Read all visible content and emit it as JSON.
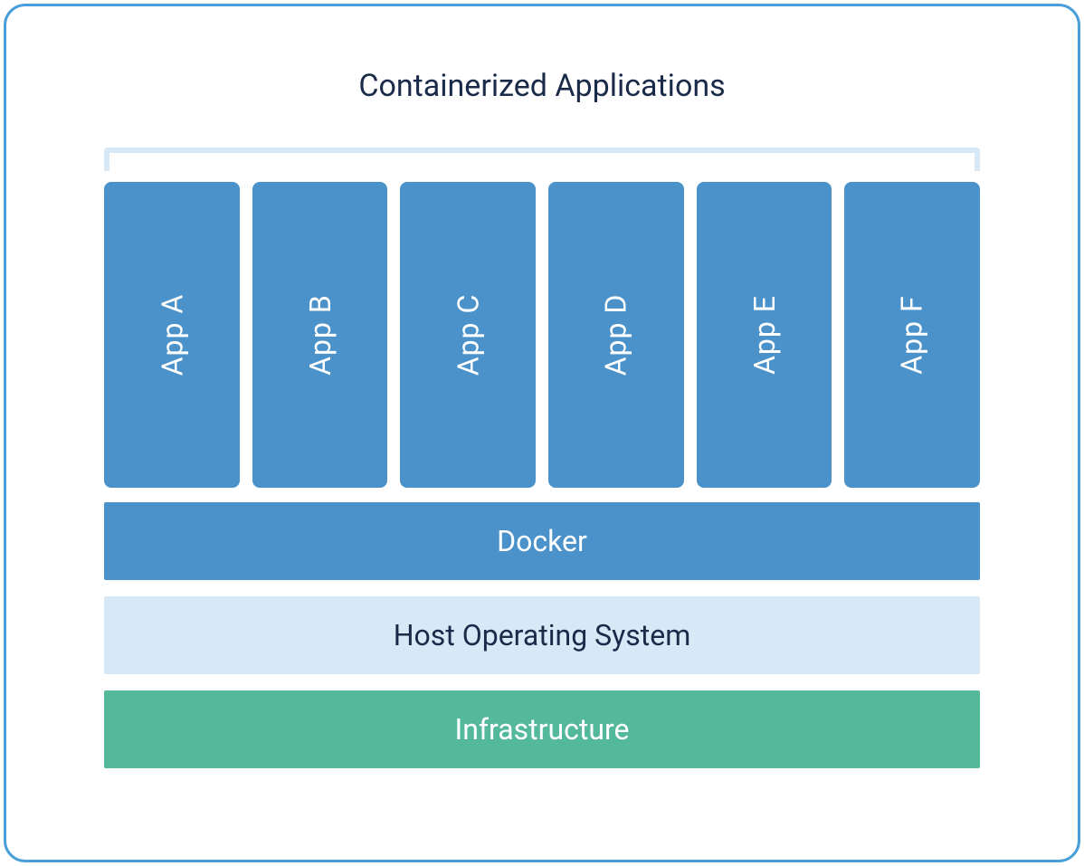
{
  "diagram": {
    "title": "Containerized Applications",
    "apps": {
      "0": {
        "label": "App A"
      },
      "1": {
        "label": "App B"
      },
      "2": {
        "label": "App C"
      },
      "3": {
        "label": "App D"
      },
      "4": {
        "label": "App E"
      },
      "5": {
        "label": "App F"
      }
    },
    "layers": {
      "docker": "Docker",
      "host": "Host Operating System",
      "infrastructure": "Infrastructure"
    }
  },
  "colors": {
    "frame_border": "#4a9ed9",
    "title_text": "#1a2b4a",
    "bracket": "#d7e8f7",
    "app_box": "#4a92c9",
    "app_text": "#ffffff",
    "docker_bg": "#4a92c9",
    "docker_text": "#ffffff",
    "host_bg": "#d7e8f7",
    "host_text": "#1a2b4a",
    "infra_bg": "#54b99a",
    "infra_text": "#ffffff"
  }
}
